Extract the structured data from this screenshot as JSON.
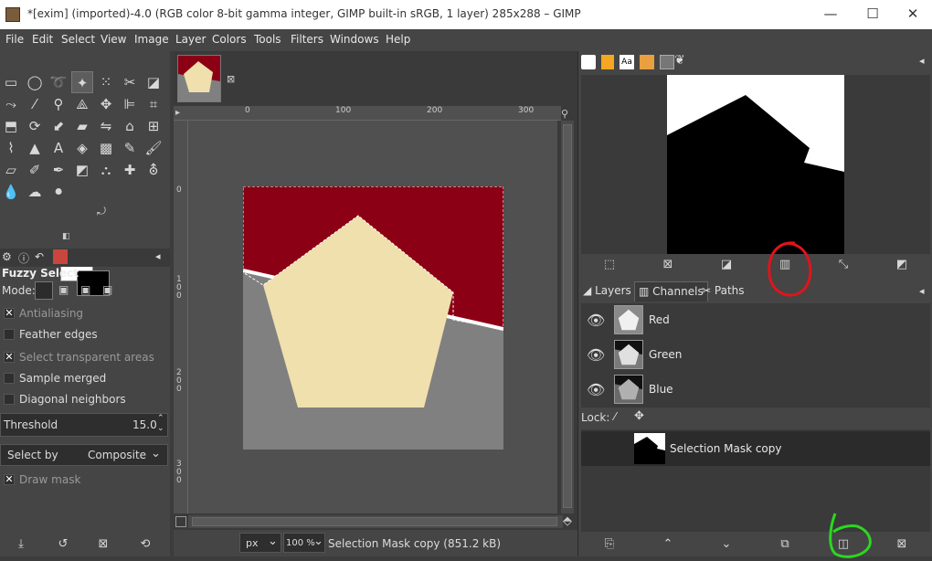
{
  "window": {
    "title": "*[exim] (imported)-4.0 (RGB color 8-bit gamma integer, GIMP built-in sRGB, 1 layer) 285x288 – GIMP",
    "minimize": "—",
    "maximize": "☐",
    "close": "✕"
  },
  "menu": [
    "File",
    "Edit",
    "Select",
    "View",
    "Image",
    "Layer",
    "Colors",
    "Tools",
    "Filters",
    "Windows",
    "Help"
  ],
  "tool_options": {
    "title": "Fuzzy Select",
    "mode_label": "Mode:",
    "antialiasing": "Antialiasing",
    "feather_edges": "Feather edges",
    "select_transparent": "Select transparent areas",
    "sample_merged": "Sample merged",
    "diagonal_neighbors": "Diagonal neighbors",
    "threshold_label": "Threshold",
    "threshold_value": "15.0",
    "select_by_label": "Select by",
    "select_by_value": "Composite",
    "draw_mask": "Draw mask"
  },
  "rulers": {
    "h": [
      "0",
      "100",
      "200",
      "300"
    ],
    "v": [
      "0",
      "1\n0\n0",
      "2\n0\n0",
      "3\n0\n0"
    ]
  },
  "status": {
    "unit": "px",
    "zoom": "100 %",
    "message": "Selection Mask copy (851.2 kB)"
  },
  "dock_tabs": {
    "layers": "Layers",
    "channels": "Channels",
    "paths": "Paths"
  },
  "channels": [
    {
      "name": "Red"
    },
    {
      "name": "Green"
    },
    {
      "name": "Blue"
    }
  ],
  "lock_label": "Lock:",
  "selection_mask": "Selection Mask copy",
  "colors": {
    "image_red": "#8b0015",
    "image_pentagon": "#efe0ad",
    "image_gray": "#808080",
    "annotation_red": "#e0141b",
    "annotation_green": "#2bd81f"
  }
}
